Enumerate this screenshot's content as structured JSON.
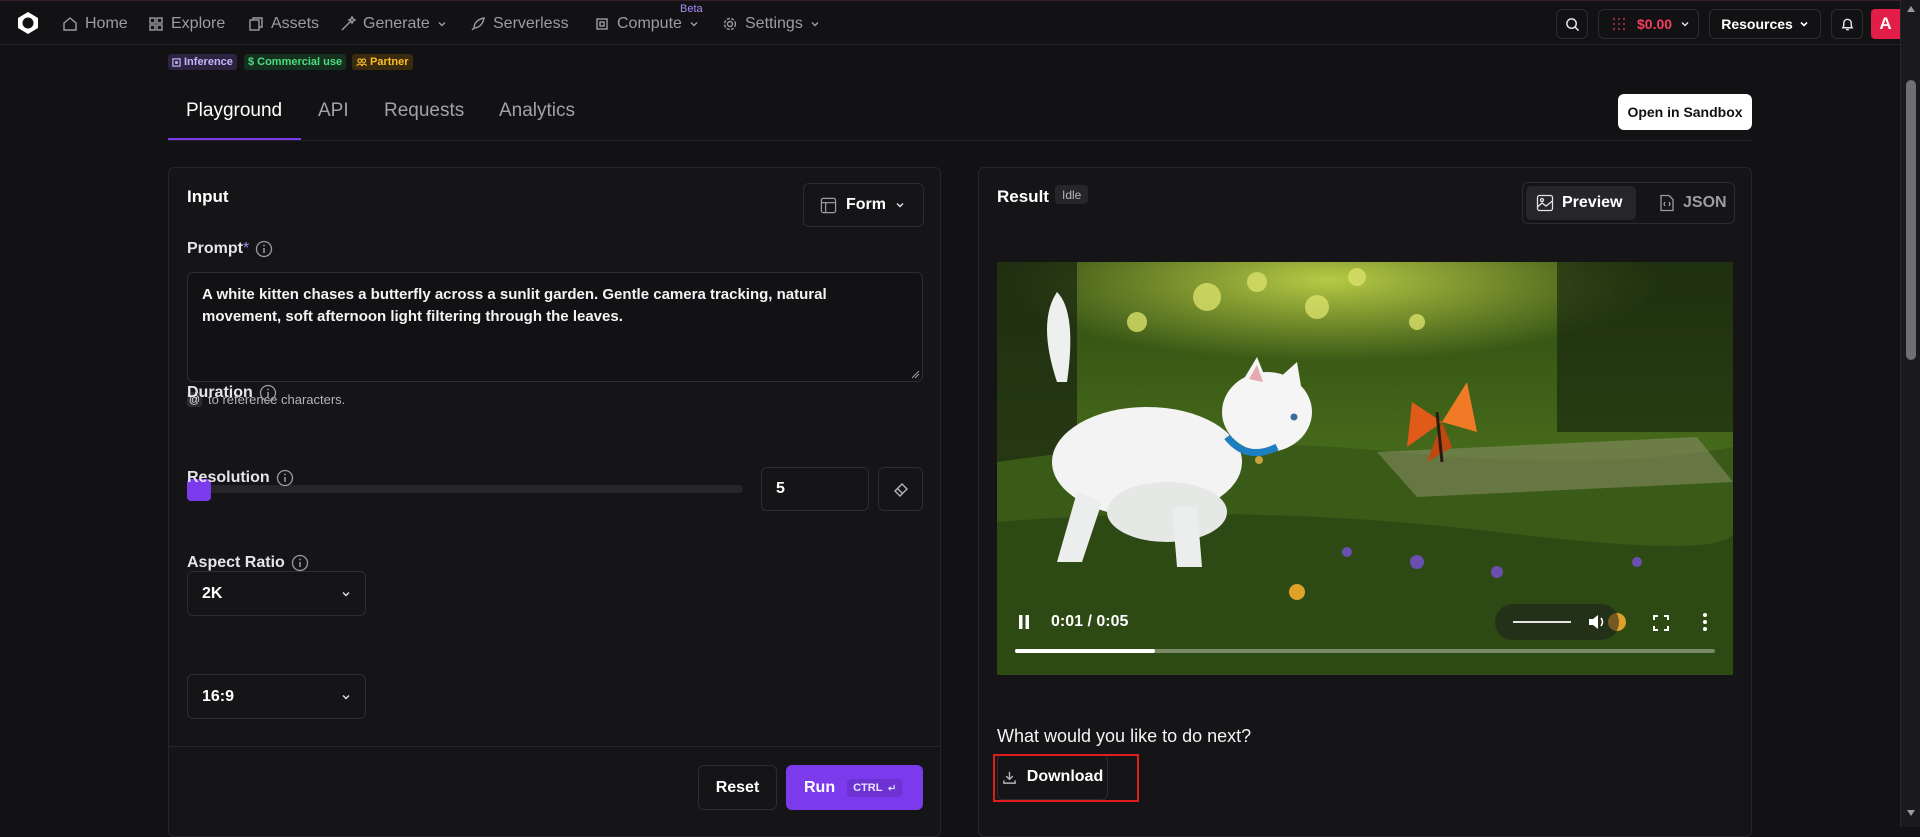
{
  "nav": {
    "items": [
      {
        "label": "Home",
        "icon": "home-icon"
      },
      {
        "label": "Explore",
        "icon": "grid-icon"
      },
      {
        "label": "Assets",
        "icon": "assets-icon"
      },
      {
        "label": "Generate",
        "icon": "wand-icon"
      },
      {
        "label": "Serverless",
        "icon": "rocket-icon"
      },
      {
        "label": "Compute",
        "icon": "chip-icon"
      },
      {
        "label": "Settings",
        "icon": "gear-icon"
      }
    ],
    "compute_badge": "Beta",
    "balance": "$0.00",
    "resources_label": "Resources",
    "avatar_initial": "A"
  },
  "badges": {
    "inference": "Inference",
    "commercial": "Commercial use",
    "partner": "Partner"
  },
  "tabs": [
    "Playground",
    "API",
    "Requests",
    "Analytics"
  ],
  "open_sandbox_label": "Open in Sandbox",
  "input": {
    "title": "Input",
    "mode": "Form",
    "prompt_label": "Prompt",
    "prompt_required_mark": "*",
    "prompt_value": "A white kitten chases a butterfly across a sunlit garden. Gentle camera tracking, natural movement, soft afternoon light filtering through the leaves.",
    "hint_symbol": "@",
    "hint_text": "to reference characters.",
    "duration_label": "Duration",
    "duration_value": "5",
    "resolution_label": "Resolution",
    "resolution_value": "2K",
    "aspect_label": "Aspect Ratio",
    "aspect_value": "16:9",
    "reset_label": "Reset",
    "run_label": "Run",
    "run_shortcut": "CTRL"
  },
  "result": {
    "title": "Result",
    "status": "Idle",
    "preview_label": "Preview",
    "json_label": "JSON",
    "video_time": "0:01 / 0:05",
    "video_progress": 0.2,
    "next_prompt": "What would you like to do next?",
    "download_label": "Download"
  },
  "colors": {
    "accent": "#7c3aed",
    "balance": "#f43f5e",
    "highlight": "#e01e1e"
  }
}
